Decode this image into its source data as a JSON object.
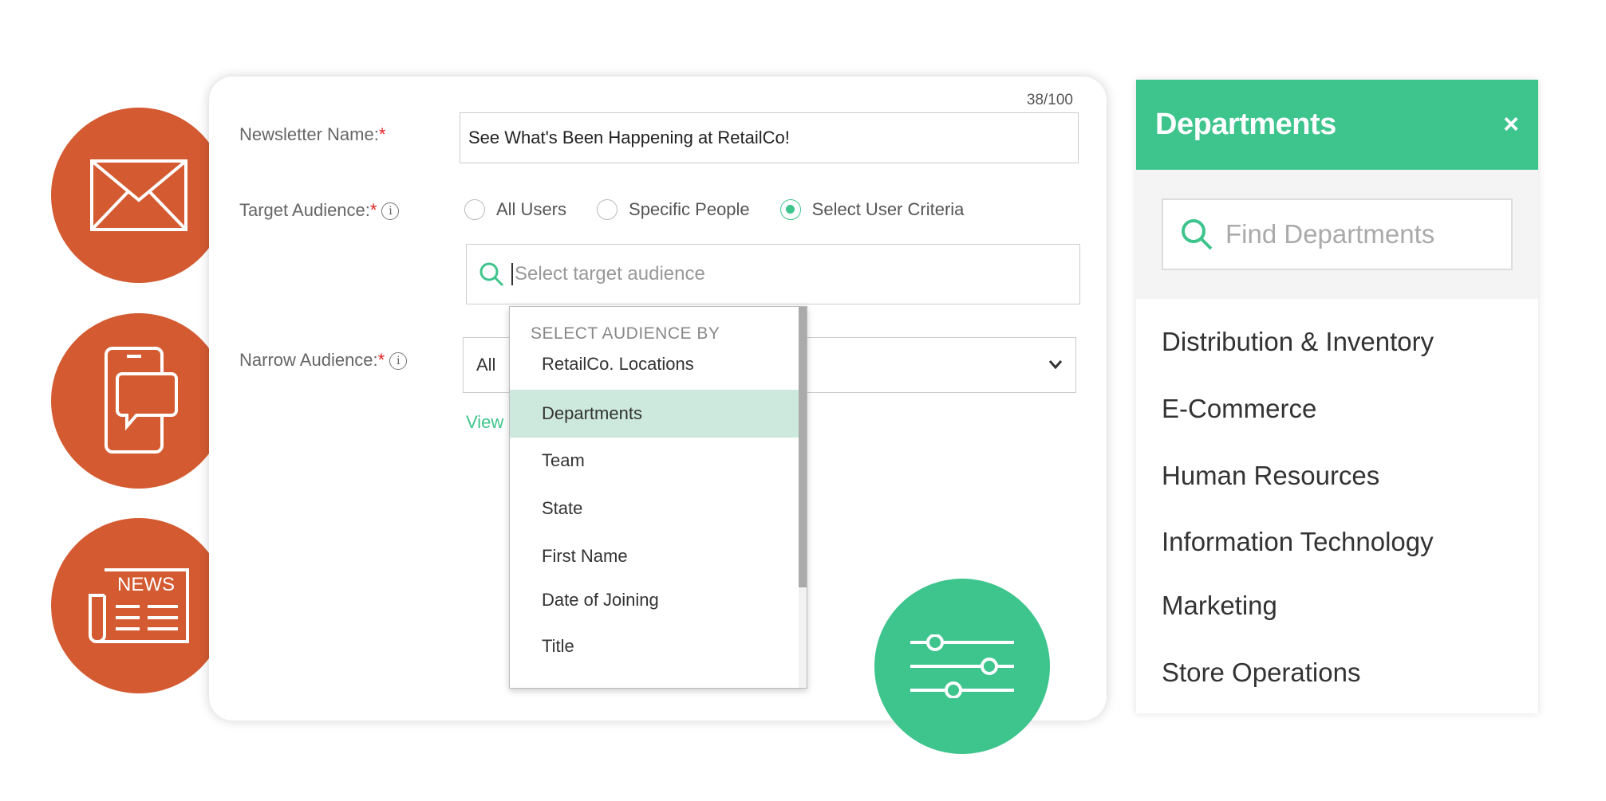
{
  "form": {
    "counter": "38/100",
    "newsletter_label": "Newsletter Name:",
    "required_mark": "*",
    "newsletter_value": "See What's Been Happening at RetailCo!",
    "target_label": "Target Audience:",
    "info_glyph": "i",
    "radios": [
      {
        "label": "All Users",
        "checked": false
      },
      {
        "label": "Specific People",
        "checked": false
      },
      {
        "label": "Select User Criteria",
        "checked": true
      }
    ],
    "search_placeholder": "Select target audience",
    "narrow_label": "Narrow Audience:",
    "narrow_value": "All",
    "view_link": "View"
  },
  "dropdown": {
    "header": "SELECT AUDIENCE BY",
    "items": [
      "RetailCo. Locations",
      "Departments",
      "Team",
      "State",
      "First Name",
      "Date of Joining",
      "Title"
    ],
    "active_index": 1
  },
  "panel": {
    "title": "Departments",
    "close": "×",
    "search_placeholder": "Find Departments",
    "items": [
      "Distribution & Inventory",
      "E-Commerce",
      "Human Resources",
      "Information Technology",
      "Marketing",
      "Store Operations"
    ]
  },
  "decor": {
    "news_text": "NEWS",
    "icons": [
      "envelope-icon",
      "mobile-chat-icon",
      "newspaper-icon",
      "sliders-icon"
    ],
    "colors": {
      "orange": "#d45a31",
      "green": "#3ec48d",
      "highlight": "#cde9dd",
      "required": "#e02020"
    }
  }
}
